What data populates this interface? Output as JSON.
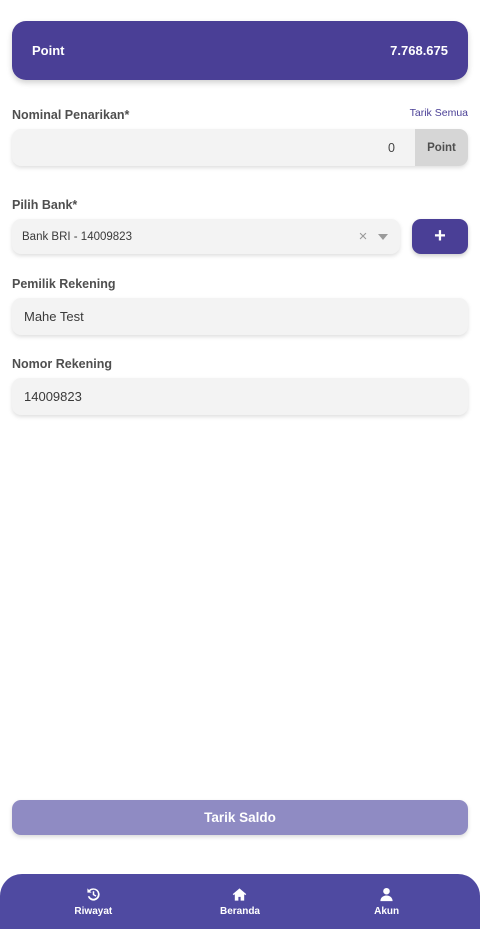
{
  "balance": {
    "label": "Point",
    "value": "7.768.675"
  },
  "withdrawal": {
    "label": "Nominal Penarikan*",
    "withdraw_all_link": "Tarik Semua",
    "amount_value": "0",
    "unit": "Point"
  },
  "bank": {
    "label": "Pilih Bank*",
    "selected": "Bank BRI - 14009823",
    "add_button": "+"
  },
  "account_owner": {
    "label": "Pemilik Rekening",
    "value": "Mahe Test"
  },
  "account_number": {
    "label": "Nomor Rekening",
    "value": "14009823"
  },
  "submit_label": "Tarik Saldo",
  "bottom_nav": [
    {
      "label": "Riwayat",
      "icon": "history-icon"
    },
    {
      "label": "Beranda",
      "icon": "home-icon"
    },
    {
      "label": "Akun",
      "icon": "user-icon"
    }
  ],
  "colors": {
    "primary": "#4a3f96",
    "nav": "#4f4aa1",
    "button_disabled": "#8f8bc3",
    "field_bg": "#f3f3f3"
  }
}
